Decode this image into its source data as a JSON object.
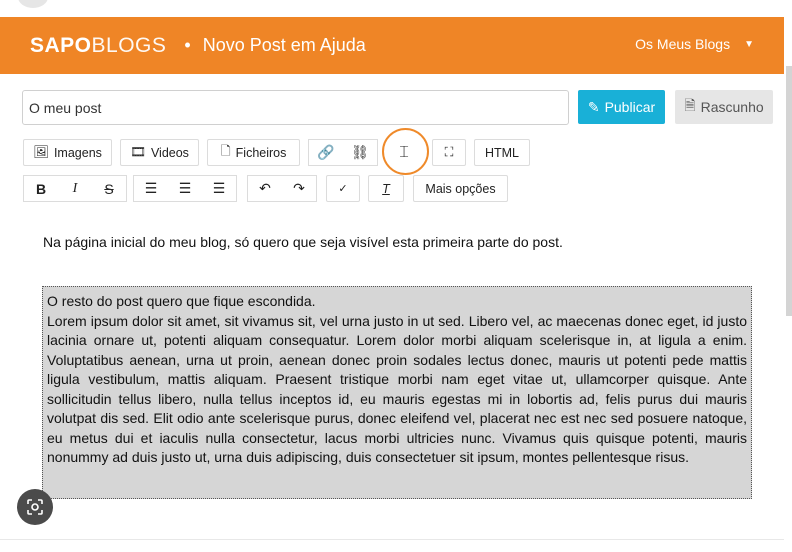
{
  "header": {
    "logo_bold": "SAPO",
    "logo_thin": "BLOGS",
    "separator": "•",
    "blog_name": "Novo Post em Ajuda",
    "my_blogs": "Os Meus Blogs",
    "brand_color": "#ef8526"
  },
  "post": {
    "title_value": "O meu post",
    "publish_label": "Publicar",
    "draft_label": "Rascunho"
  },
  "toolbar": {
    "images_label": "Imagens",
    "videos_label": "Videos",
    "files_label": "Ficheiros",
    "html_label": "HTML",
    "more_options_label": "Mais opções"
  },
  "editor": {
    "intro_text": "Na página inicial do meu blog, só quero que seja visível esta primeira parte do post.",
    "hidden_first_line": "O resto do post quero que fique escondida.",
    "hidden_body": "Lorem ipsum dolor sit amet, sit vivamus sit, vel urna justo in ut sed. Libero vel, ac maecenas donec eget, id justo lacinia ornare ut, potenti aliquam consequatur. Lorem dolor morbi aliquam scelerisque in, at ligula a enim. Voluptatibus aenean, urna ut proin, aenean donec proin sodales lectus donec, mauris ut potenti pede mattis ligula vestibulum, mattis aliquam. Praesent tristique morbi nam eget vitae ut, ullamcorper quisque. Ante sollicitudin tellus libero, nulla tellus inceptos id, eu mauris egestas mi in lobortis ad, felis purus dui mauris volutpat dis sed. Elit odio ante scelerisque purus, donec eleifend vel, placerat nec est nec sed posuere natoque, eu metus dui et iaculis nulla consectetur, lacus morbi ultricies nunc. Vivamus quis quisque potenti, mauris nonummy ad duis justo ut, urna duis adipiscing, duis consectetuer sit ipsum, montes pellentesque risus."
  }
}
